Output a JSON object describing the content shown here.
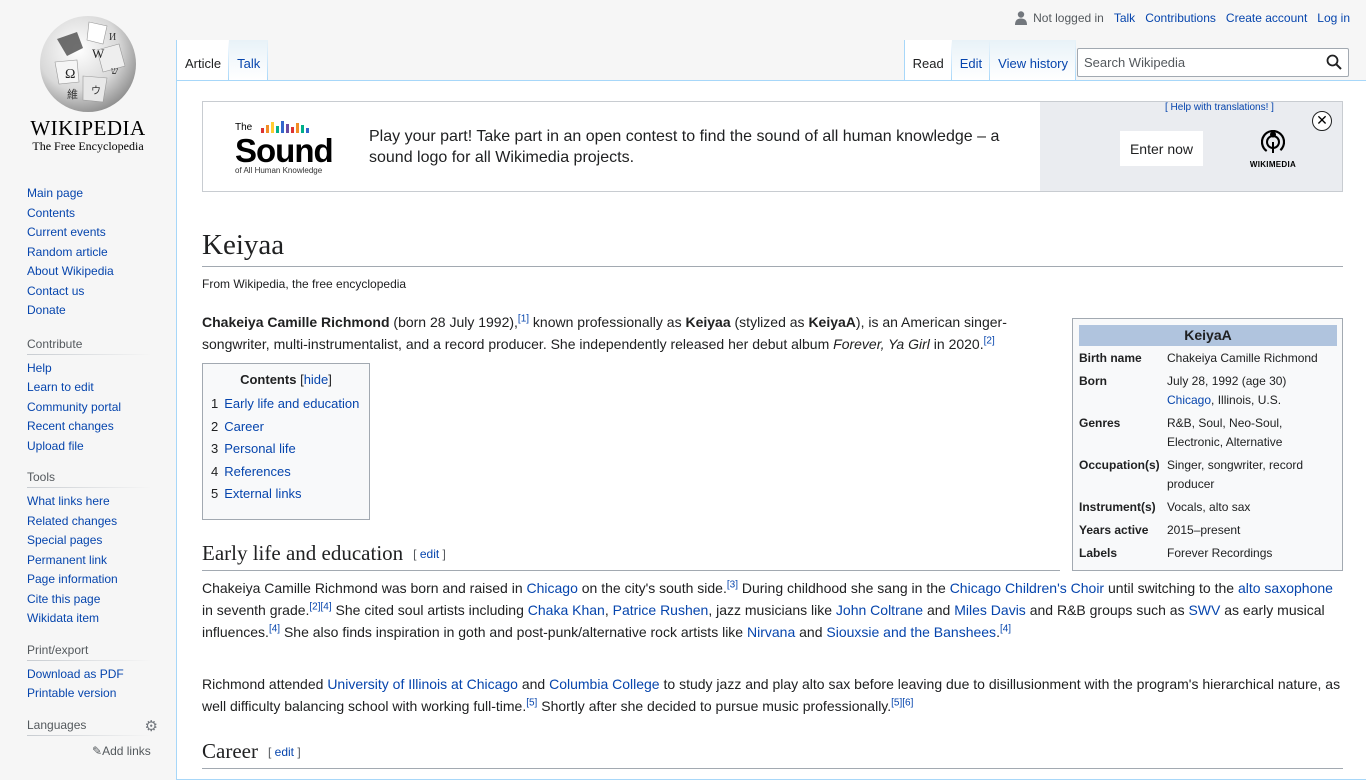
{
  "logo": {
    "wordmark": "WIKIPEDIA",
    "tagline": "The Free Encyclopedia"
  },
  "personal": {
    "status": "Not logged in",
    "links": [
      "Talk",
      "Contributions",
      "Create account",
      "Log in"
    ]
  },
  "tabs": {
    "left": [
      "Article",
      "Talk"
    ],
    "right": [
      "Read",
      "Edit",
      "View history"
    ]
  },
  "search": {
    "placeholder": "Search Wikipedia"
  },
  "sidebar": {
    "navigation": [
      "Main page",
      "Contents",
      "Current events",
      "Random article",
      "About Wikipedia",
      "Contact us",
      "Donate"
    ],
    "contribute": {
      "heading": "Contribute",
      "items": [
        "Help",
        "Learn to edit",
        "Community portal",
        "Recent changes",
        "Upload file"
      ]
    },
    "tools": {
      "heading": "Tools",
      "items": [
        "What links here",
        "Related changes",
        "Special pages",
        "Permanent link",
        "Page information",
        "Cite this page",
        "Wikidata item"
      ]
    },
    "print": {
      "heading": "Print/export",
      "items": [
        "Download as PDF",
        "Printable version"
      ]
    },
    "languages": {
      "heading": "Languages",
      "add_links": "Add links"
    }
  },
  "banner": {
    "logo_the": "The",
    "logo_word": "Sound",
    "logo_sub": "of All Human Knowledge",
    "message": "Play your part! Take part in an open contest to find the sound of all human knowledge – a sound logo for all Wikimedia projects.",
    "help_translations": "[ Help with translations! ]",
    "enter_button": "Enter now",
    "wikimedia_label": "WIKIMEDIA",
    "close": "✕",
    "bar_colors": [
      "#d33",
      "#f28d25",
      "#fc3",
      "#00af89",
      "#36c",
      "#6b4ba1",
      "#d33",
      "#f28d25",
      "#00af89",
      "#36c"
    ]
  },
  "article": {
    "title": "Keiyaa",
    "from": "From Wikipedia, the free encyclopedia",
    "lead": {
      "name": "Chakeiya Camille Richmond",
      "t1": " (born 28 July 1992),",
      "ref1": "[1]",
      "t2": " known professionally as ",
      "stage": "Keiyaa",
      "t3": " (stylized as ",
      "styled": "KeiyaA",
      "t4": "), is an American singer-songwriter, multi-instrumentalist, and a record producer. She independently released her debut album ",
      "album": "Forever, Ya Girl",
      "t5": " in 2020.",
      "ref2": "[2]"
    },
    "toc": {
      "title": "Contents",
      "hide": "hide",
      "items": [
        {
          "num": "1",
          "label": "Early life and education"
        },
        {
          "num": "2",
          "label": "Career"
        },
        {
          "num": "3",
          "label": "Personal life"
        },
        {
          "num": "4",
          "label": "References"
        },
        {
          "num": "5",
          "label": "External links"
        }
      ]
    },
    "sections": {
      "early": "Early life and education",
      "career": "Career",
      "edit": "edit"
    },
    "early_p1": {
      "a": "Chakeiya Camille Richmond was born and raised in ",
      "chicago": "Chicago",
      "b": " on the city's south side.",
      "r3": "[3]",
      "c": " During childhood she sang in the ",
      "choir": "Chicago Children's Choir",
      "d": " until switching to the ",
      "sax": "alto saxophone",
      "e": " in seventh grade.",
      "r24": "[2][4]",
      "f": " She cited soul artists including ",
      "khan": "Chaka Khan",
      "g": ", ",
      "rushen": "Patrice Rushen",
      "h": ", jazz musicians like ",
      "coltrane": "John Coltrane",
      "i": " and ",
      "davis": "Miles Davis",
      "j": " and R&B groups such as ",
      "swv": "SWV",
      "k": " as early musical influences.",
      "r4": "[4]",
      "l": " She also finds inspiration in goth and post-punk/alternative rock artists like ",
      "nirvana": "Nirvana",
      "m": " and ",
      "siouxsie": "Siouxsie and the Banshees",
      "n": ".",
      "r4b": "[4]"
    },
    "early_p2": {
      "a": "Richmond attended ",
      "uic": "University of Illinois at Chicago",
      "b": " and ",
      "columbia": "Columbia College",
      "c": " to study jazz and play alto sax before leaving due to disillusionment with the program's hierarchical nature, as well difficulty balancing school with working full-time.",
      "r5": "[5]",
      "d": " Shortly after she decided to pursue music professionally.",
      "r56": "[5][6]"
    },
    "infobox": {
      "title": "KeiyaA",
      "rows": [
        {
          "label": "Birth name",
          "value": "Chakeiya Camille Richmond"
        },
        {
          "label": "Born",
          "value": "July 28, 1992 (age 30)",
          "link": "Chicago",
          "rest": ", Illinois, U.S."
        },
        {
          "label": "Genres",
          "value": "R&B, Soul, Neo-Soul, Electronic, Alternative"
        },
        {
          "label": "Occupation(s)",
          "value": "Singer, songwriter, record producer"
        },
        {
          "label": "Instrument(s)",
          "value": "Vocals, alto sax"
        },
        {
          "label": "Years active",
          "value": "2015–present"
        },
        {
          "label": "Labels",
          "value": "Forever Recordings"
        }
      ]
    }
  }
}
